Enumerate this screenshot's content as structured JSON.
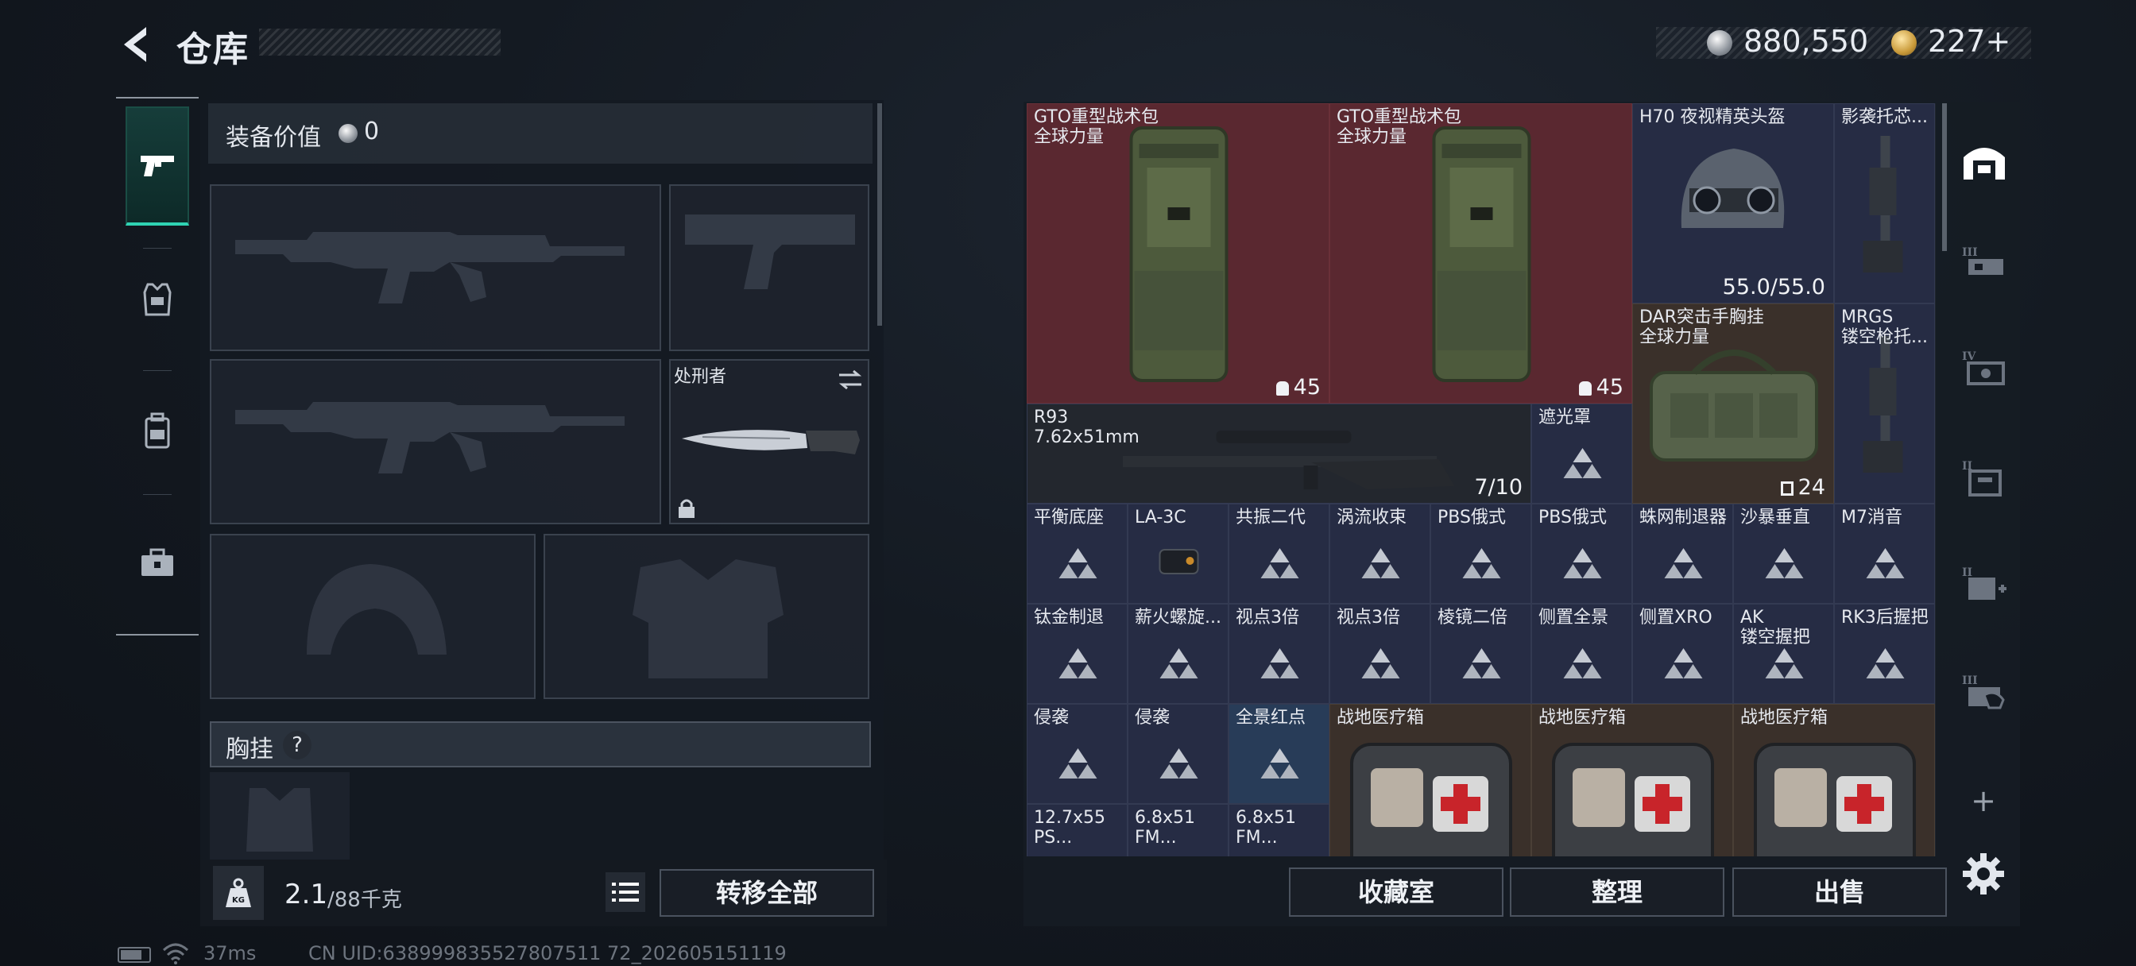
{
  "header": {
    "title": "仓库"
  },
  "currency": {
    "silver": "880,550",
    "gold": "227+"
  },
  "loadout": {
    "equip_label": "装备价值",
    "equip_value": "0",
    "knife_name": "处刑者",
    "chest_label": "胸挂",
    "chest_help": "?"
  },
  "weight": {
    "current": "2.1",
    "max": "/88千克"
  },
  "buttons": {
    "transfer_all": "转移全部",
    "collection": "收藏室",
    "sort": "整理",
    "sell": "出售"
  },
  "status": {
    "ping": "37ms",
    "uid": "CN UID:638999835527807511 72_202605151119"
  },
  "storage": {
    "items": [
      {
        "name": "GTO重型战术包\n全球力量",
        "count": "45",
        "color": "red",
        "icon": "backpack-icon"
      },
      {
        "name": "GTO重型战术包\n全球力量",
        "count": "45",
        "color": "red",
        "icon": "backpack-icon"
      },
      {
        "name": "H70 夜视精英头盔",
        "count": "55.0/55.0",
        "color": "navy",
        "icon": "night-vision-helmet-icon"
      },
      {
        "name": "影袭托芯...",
        "count": "",
        "color": "navy",
        "icon": "stock-icon"
      },
      {
        "name": "DAR突击手胸挂\n全球力量",
        "count": "24",
        "color": "brown",
        "icon": "chest-rig-icon"
      },
      {
        "name": "MRGS\n镂空枪托...",
        "count": "",
        "color": "navy",
        "icon": "stock-icon"
      },
      {
        "name": "R93\n7.62x51mm",
        "count": "7/10",
        "color": "dark",
        "icon": "sniper-rifle-icon"
      },
      {
        "name": "遮光罩",
        "count": "",
        "color": "navy",
        "icon": "placeholder-triangle-icon"
      },
      {
        "name": "平衡底座",
        "count": "",
        "color": "navy",
        "icon": "placeholder-triangle-icon"
      },
      {
        "name": "LA-3C",
        "count": "",
        "color": "navy",
        "icon": "laser-sight-icon"
      },
      {
        "name": "共振二代",
        "count": "",
        "color": "navy",
        "icon": "placeholder-triangle-icon"
      },
      {
        "name": "涡流收束",
        "count": "",
        "color": "navy",
        "icon": "placeholder-triangle-icon"
      },
      {
        "name": "PBS俄式",
        "count": "",
        "color": "navy",
        "icon": "placeholder-triangle-icon"
      },
      {
        "name": "PBS俄式",
        "count": "",
        "color": "navy",
        "icon": "placeholder-triangle-icon"
      },
      {
        "name": "蛛网制退器",
        "count": "",
        "color": "navy",
        "icon": "placeholder-triangle-icon"
      },
      {
        "name": "沙暴垂直",
        "count": "",
        "color": "navy",
        "icon": "placeholder-triangle-icon"
      },
      {
        "name": "M7消音",
        "count": "",
        "color": "navy",
        "icon": "placeholder-triangle-icon"
      },
      {
        "name": "钛金制退",
        "count": "",
        "color": "navy",
        "icon": "placeholder-triangle-icon"
      },
      {
        "name": "薪火螺旋...",
        "count": "",
        "color": "navy",
        "icon": "placeholder-triangle-icon"
      },
      {
        "name": "视点3倍",
        "count": "",
        "color": "navy",
        "icon": "placeholder-triangle-icon"
      },
      {
        "name": "视点3倍",
        "count": "",
        "color": "navy",
        "icon": "placeholder-triangle-icon"
      },
      {
        "name": "棱镜二倍",
        "count": "",
        "color": "navy",
        "icon": "placeholder-triangle-icon"
      },
      {
        "name": "侧置全景",
        "count": "",
        "color": "navy",
        "icon": "placeholder-triangle-icon"
      },
      {
        "name": "侧置XRO",
        "count": "",
        "color": "navy",
        "icon": "placeholder-triangle-icon"
      },
      {
        "name": "AK\n镂空握把",
        "count": "",
        "color": "navy",
        "icon": "placeholder-triangle-icon"
      },
      {
        "name": "RK3后握把",
        "count": "",
        "color": "navy",
        "icon": "placeholder-triangle-icon"
      },
      {
        "name": "侵袭",
        "count": "",
        "color": "navy",
        "icon": "placeholder-triangle-icon"
      },
      {
        "name": "侵袭",
        "count": "",
        "color": "navy",
        "icon": "placeholder-triangle-icon"
      },
      {
        "name": "全景红点",
        "count": "",
        "color": "blue",
        "icon": "placeholder-triangle-icon"
      },
      {
        "name": "战地医疗箱",
        "count": "",
        "color": "brown",
        "icon": "medkit-icon"
      },
      {
        "name": "战地医疗箱",
        "count": "",
        "color": "brown",
        "icon": "medkit-icon"
      },
      {
        "name": "战地医疗箱",
        "count": "",
        "color": "brown",
        "icon": "medkit-icon"
      },
      {
        "name": "12.7x55\nPS...",
        "count": "",
        "color": "navy",
        "icon": "ammo-icon"
      },
      {
        "name": "6.8x51\nFM...",
        "count": "",
        "color": "navy",
        "icon": "ammo-icon"
      },
      {
        "name": "6.8x51\nFM...",
        "count": "",
        "color": "navy",
        "icon": "ammo-icon"
      }
    ]
  },
  "colors": {
    "accent": "#2fd3b3",
    "item_red": "#5a2830",
    "item_navy": "#262c44",
    "item_brown": "#3a302a",
    "item_blue": "#283c58"
  }
}
